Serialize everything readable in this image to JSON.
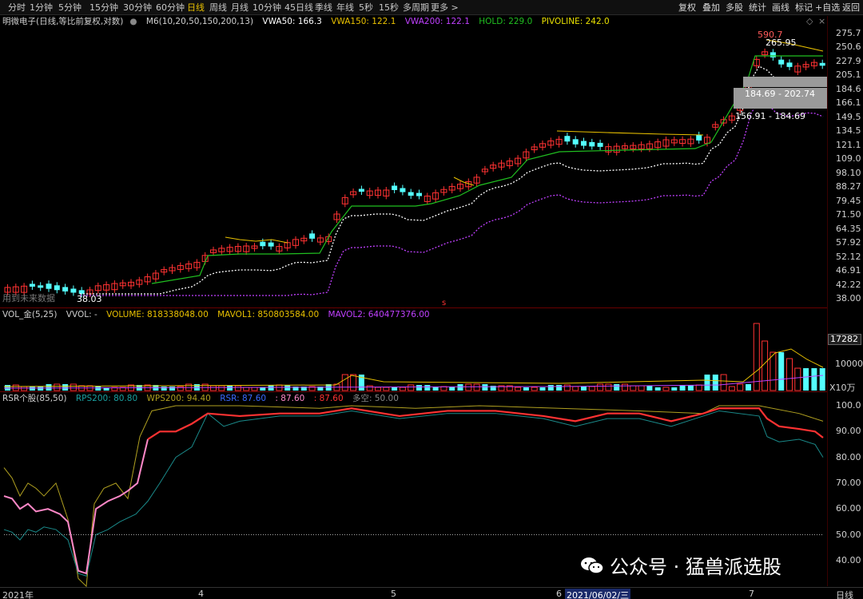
{
  "toolbar": {
    "periods": [
      "分时",
      "1分钟",
      "5分钟",
      "15分钟",
      "30分钟",
      "60分钟",
      "日线",
      "周线",
      "月线",
      "10分钟",
      "45日线",
      "季线",
      "年线",
      "5秒",
      "15秒",
      "多周期",
      "更多 >"
    ],
    "active_period": "日线",
    "right_buttons": [
      "复权",
      "叠加",
      "多股",
      "统计",
      "画线",
      "标记",
      "+自选",
      "返回"
    ]
  },
  "main_legend": {
    "stock": "明微电子(日线,等比前复权,对数)",
    "ma": "M6(10,20,50,150,200,13)",
    "vwa50": "VWA50: 166.3",
    "vwa150": "VWA150: 122.1",
    "vwa200": "VWA200: 122.1",
    "hold": "HOLD: 229.0",
    "pivoline": "PIVOLINE: 242.0"
  },
  "main_chart": {
    "y_axis_labels": [
      "275.7",
      "250.6",
      "227.9",
      "205.1",
      "184.6",
      "166.1",
      "149.5",
      "134.5",
      "121.1",
      "109.0",
      "98.10",
      "88.27",
      "79.45",
      "71.50",
      "64.35",
      "57.92",
      "52.12",
      "46.91",
      "42.22",
      "38.00"
    ],
    "high_label": "590.7",
    "high_note": "265.95",
    "low_label": "38.03",
    "box_upper": "",
    "box_lower": "184.69 - 202.74",
    "range_note": "156.91 - 184.69",
    "note_bottom_left": "用到未来数据",
    "marker": "s"
  },
  "volume_legend": {
    "name": "VOL_金(5,25)",
    "vvol": "VVOL: -",
    "volume": "VOLUME: 818338048.00",
    "mavol1": "MAVOL1: 850803584.00",
    "mavol2": "MAVOL2: 640477376.00"
  },
  "volume_axis": {
    "top_value": "17282",
    "mid_value": "10000",
    "unit": "X10万"
  },
  "rsr_legend": {
    "name": "RSR个股(85,50)",
    "rps200": "RPS200: 80.80",
    "wps200": "WPS200: 94.40",
    "rsr": "RSR: 87.60",
    "rsr_a": ": 87.60",
    "rsr_b": ": 87.60",
    "duokong": "多空: 50.00"
  },
  "rsr_axis": [
    "100.0",
    "90.00",
    "80.00",
    "70.00",
    "60.00",
    "50.00",
    "40.00"
  ],
  "dates": {
    "start": "2021年",
    "m4": "4",
    "m5": "5",
    "m6": "6",
    "cursor": "2021/06/02/三",
    "m7": "7",
    "period": "日线"
  },
  "watermark": "公众号 · 猛兽派选股",
  "colors": {
    "up": "#ff3232",
    "down": "#54ffff",
    "yellow": "#e8c000",
    "green": "#20c020",
    "white": "#ffffff",
    "magenta": "#c040ff",
    "pink": "#ff88c8",
    "teal": "#1a8a8a",
    "olive": "#b0a020"
  }
}
